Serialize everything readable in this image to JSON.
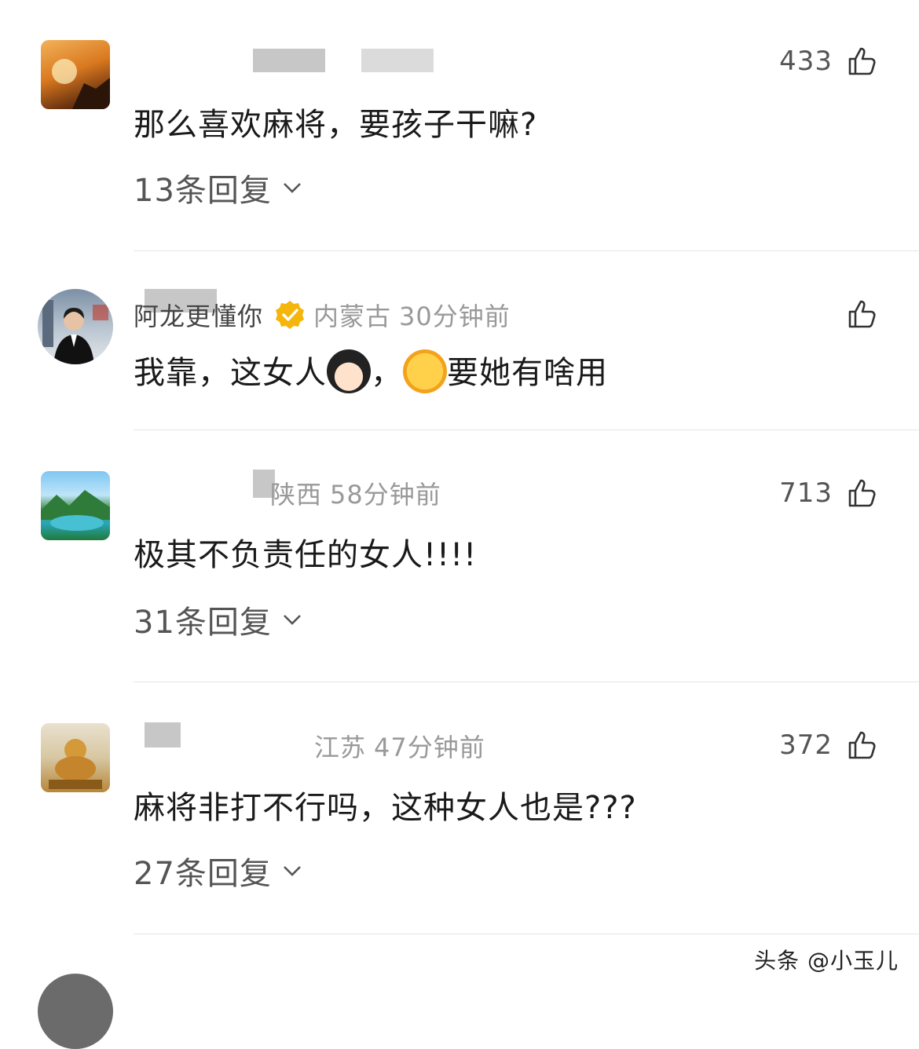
{
  "comments": [
    {
      "username": "",
      "location": "",
      "time": "",
      "likes": "433",
      "text": "那么喜欢麻将，要孩子干嘛?",
      "replies": "13条回复"
    },
    {
      "username": "阿龙更懂你",
      "location": "内蒙古",
      "time": "30分钟前",
      "likes": "",
      "text_parts": [
        "我靠，这女人",
        "，",
        "要她有啥用"
      ],
      "replies": ""
    },
    {
      "username": "",
      "location": "陕西",
      "time": "58分钟前",
      "likes": "713",
      "text": "极其不负责任的女人!!!!",
      "replies": "31条回复"
    },
    {
      "username": "",
      "location": "江苏",
      "time": "47分钟前",
      "likes": "372",
      "text": "麻将非打不行吗，这种女人也是???",
      "replies": "27条回复"
    }
  ],
  "watermark": "头条 @小玉儿",
  "icons": {
    "like": "thumbs-up-icon",
    "verified": "verified-badge-icon",
    "expand": "chevron-down-icon"
  },
  "colors": {
    "verified": "#f5b50a",
    "meta": "#999999",
    "text": "#1a1a1a"
  }
}
